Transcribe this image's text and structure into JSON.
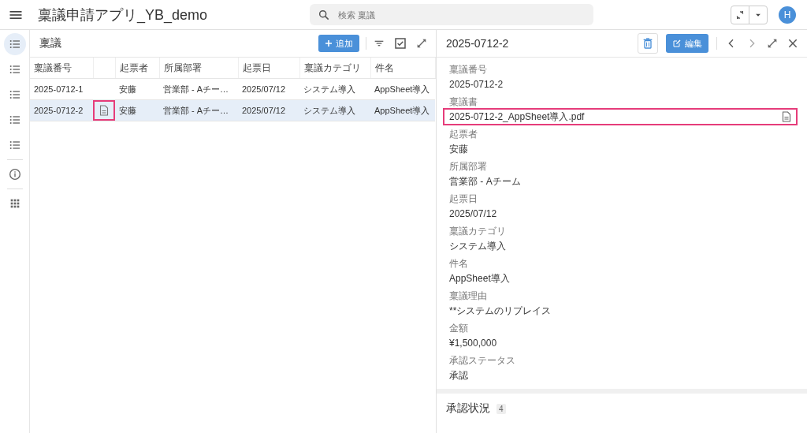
{
  "app_bar": {
    "title": "稟議申請アプリ_YB_demo",
    "search": {
      "placeholder": "検索 稟議"
    },
    "avatar": "H"
  },
  "nav": [
    {
      "kind": "list",
      "selected": true
    },
    {
      "kind": "list",
      "selected": false
    },
    {
      "kind": "list",
      "selected": false
    },
    {
      "kind": "list",
      "selected": false
    },
    {
      "kind": "list",
      "selected": false
    },
    {
      "kind": "divider"
    },
    {
      "kind": "info",
      "selected": false
    },
    {
      "kind": "divider"
    },
    {
      "kind": "apps",
      "selected": false
    }
  ],
  "list": {
    "title": "稟議",
    "add_button": "追加",
    "columns": [
      "稟議番号",
      "",
      "起票者",
      "所属部署",
      "起票日",
      "稟議カテゴリ",
      "件名"
    ],
    "rows": [
      {
        "selected": false,
        "attachment": false,
        "highlighted": false,
        "cells": [
          "2025-0712-1",
          "",
          "安藤",
          "営業部 - Aチー…",
          "2025/07/12",
          "システム導入",
          "AppSheet導入"
        ]
      },
      {
        "selected": true,
        "attachment": true,
        "highlighted": true,
        "cells": [
          "2025-0712-2",
          "",
          "安藤",
          "営業部 - Aチー…",
          "2025/07/12",
          "システム導入",
          "AppSheet導入"
        ]
      }
    ]
  },
  "detail": {
    "title": "2025-0712-2",
    "edit_button": "編集",
    "fields": [
      {
        "label": "稟議番号",
        "value": "2025-0712-2",
        "kind": "text",
        "highlighted": false
      },
      {
        "label": "稟議書",
        "value": "2025-0712-2_AppSheet導入.pdf",
        "kind": "file",
        "highlighted": true
      },
      {
        "label": "起票者",
        "value": "安藤",
        "kind": "text",
        "highlighted": false
      },
      {
        "label": "所属部署",
        "value": "営業部 - Aチーム",
        "kind": "text",
        "highlighted": false
      },
      {
        "label": "起票日",
        "value": "2025/07/12",
        "kind": "text",
        "highlighted": false
      },
      {
        "label": "稟議カテゴリ",
        "value": "システム導入",
        "kind": "text",
        "highlighted": false
      },
      {
        "label": "件名",
        "value": "AppSheet導入",
        "kind": "text",
        "highlighted": false
      },
      {
        "label": "稟議理由",
        "value": "**システムのリプレイス",
        "kind": "text",
        "highlighted": false
      },
      {
        "label": "金額",
        "value": "¥1,500,000",
        "kind": "text",
        "highlighted": false
      },
      {
        "label": "承認ステータス",
        "value": "承認",
        "kind": "text",
        "highlighted": false
      }
    ],
    "section": {
      "title": "承認状況",
      "count": "4"
    }
  }
}
